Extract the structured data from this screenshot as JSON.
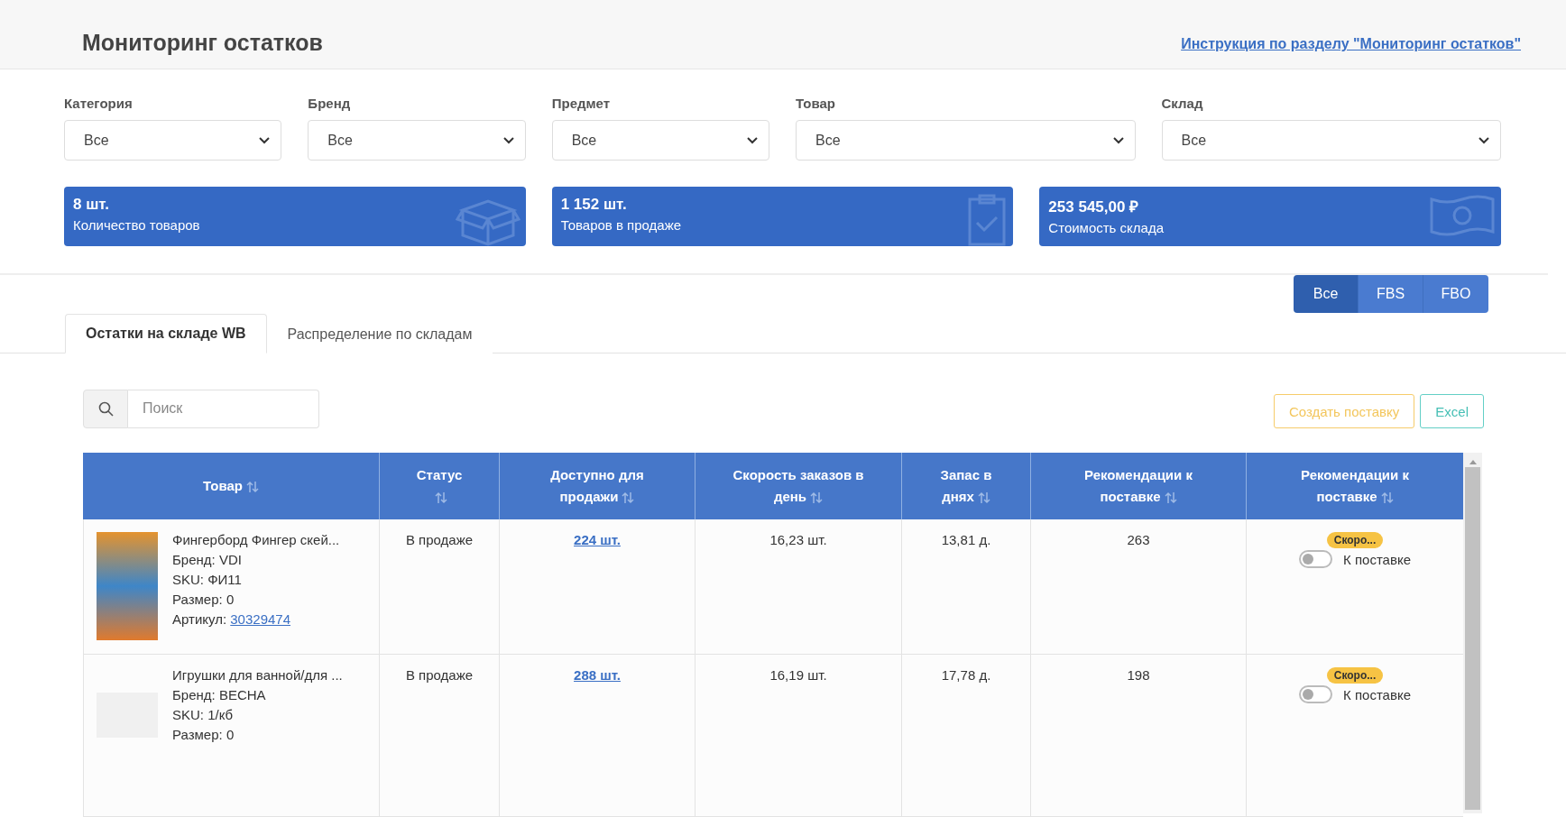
{
  "header": {
    "title": "Мониторинг остатков",
    "help_link": "Инструкция по разделу \"Мониторинг остатков\""
  },
  "filters": [
    {
      "label": "Категория",
      "value": "Все"
    },
    {
      "label": "Бренд",
      "value": "Все"
    },
    {
      "label": "Предмет",
      "value": "Все"
    },
    {
      "label": "Товар",
      "value": "Все"
    },
    {
      "label": "Склад",
      "value": "Все"
    }
  ],
  "stat_cards": [
    {
      "kind": "box",
      "value": "8 шт.",
      "label": "Количество товаров"
    },
    {
      "kind": "clipboard",
      "value": "1 152 шт.",
      "label": "Товаров в продаже"
    },
    {
      "kind": "money",
      "value": "253 545,00 ₽",
      "label": "Стоимость склада"
    }
  ],
  "mode_buttons": [
    {
      "label": "Все",
      "selected": true
    },
    {
      "label": "FBS",
      "selected": false
    },
    {
      "label": "FBO",
      "selected": false
    }
  ],
  "tabs": [
    {
      "label": "Остатки на складе WB",
      "selected": true
    },
    {
      "label": "Распределение по складам",
      "selected": false
    }
  ],
  "search": {
    "placeholder": "Поиск"
  },
  "actions": [
    {
      "kind": "warning",
      "label": "Создать поставку"
    },
    {
      "kind": "info",
      "label": "Excel"
    }
  ],
  "table": {
    "columns": [
      "Товар",
      "Статус",
      "Доступно для продажи",
      "Скорость заказов в день",
      "Запас в днях",
      "Рекомендации к поставке",
      "Рекомендации к поставке"
    ],
    "rows": [
      {
        "name": "Фингерборд Фингер скей...",
        "brand": "Бренд: VDI",
        "sku": "SKU: ФИ11",
        "size": "Размер: 0",
        "article": {
          "label": "Артикул:",
          "value": "30329474"
        },
        "status": "В продаже",
        "available": "224 шт.",
        "speed": "16,23 шт.",
        "stock_days": "13,81 д.",
        "recommended": "263",
        "badge": "Скоро...",
        "toggle_label": "К поставке",
        "on": false
      },
      {
        "name": "Игрушки для ванной/для ...",
        "brand": "Бренд: ВЕСНА",
        "sku": "SKU: 1/кб",
        "size": "Размер: 0",
        "status": "В продаже",
        "available": "288 шт.",
        "speed": "16,19 шт.",
        "stock_days": "17,78 д.",
        "recommended": "198",
        "badge": "Скоро...",
        "toggle_label": "К поставке",
        "on": false
      }
    ]
  }
}
